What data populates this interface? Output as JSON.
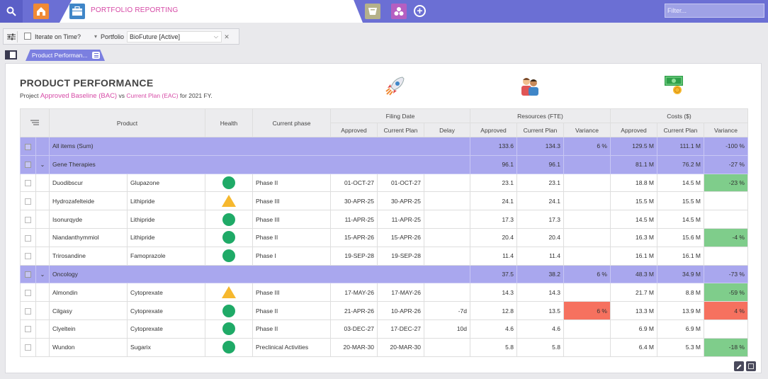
{
  "header": {
    "tab_label": "PORTFOLIO REPORTING",
    "filter_placeholder": "Filter..."
  },
  "toolbar": {
    "iterate_label": "Iterate on Time?",
    "portfolio_label": "Portfolio",
    "portfolio_value": "BioFuture [Active]"
  },
  "page_tab": {
    "label": "Product Performan..."
  },
  "report": {
    "title": "PRODUCT PERFORMANCE",
    "subtitle_prefix": "Project",
    "baseline": "Approved Baseline (BAC)",
    "vs": "vs",
    "plan": "Current Plan (EAC)",
    "suffix": "for 2021 FY."
  },
  "table": {
    "headers": {
      "product": "Product",
      "health": "Health",
      "phase": "Current phase",
      "filing": "Filing Date",
      "resources": "Resources (FTE)",
      "costs": "Costs ($)",
      "approved": "Approved",
      "current_plan": "Current Plan",
      "delay": "Delay",
      "variance": "Variance"
    },
    "rows": [
      {
        "type": "sum",
        "name": "All items (Sum)",
        "product": "",
        "health": "",
        "phase": "",
        "f_app": "",
        "f_cur": "",
        "delay": "",
        "r_app": "133.6",
        "r_cur": "134.3",
        "r_var": "6 %",
        "c_app": "129.5 M",
        "c_cur": "111.1 M",
        "c_var": "-100 %"
      },
      {
        "type": "group",
        "name": "Gene Therapies",
        "product": "",
        "health": "",
        "phase": "",
        "f_app": "",
        "f_cur": "",
        "delay": "",
        "r_app": "96.1",
        "r_cur": "96.1",
        "r_var": "",
        "c_app": "81.1 M",
        "c_cur": "76.2 M",
        "c_var": "-27 %"
      },
      {
        "type": "item",
        "name": "Duodibscur",
        "product": "Glupazone",
        "health": "green",
        "phase": "Phase II",
        "f_app": "01-OCT-27",
        "f_cur": "01-OCT-27",
        "delay": "",
        "r_app": "23.1",
        "r_cur": "23.1",
        "r_var": "",
        "c_app": "18.8 M",
        "c_cur": "14.5 M",
        "c_var": "-23 %",
        "c_var_color": "green"
      },
      {
        "type": "item",
        "name": "Hydrozafelteide",
        "product": "Lithipride",
        "health": "warning",
        "phase": "Phase III",
        "f_app": "30-APR-25",
        "f_cur": "30-APR-25",
        "delay": "",
        "r_app": "24.1",
        "r_cur": "24.1",
        "r_var": "",
        "c_app": "15.5 M",
        "c_cur": "15.5 M",
        "c_var": ""
      },
      {
        "type": "item",
        "name": "Isonurqyde",
        "product": "Lithipride",
        "health": "green",
        "phase": "Phase III",
        "f_app": "11-APR-25",
        "f_cur": "11-APR-25",
        "delay": "",
        "r_app": "17.3",
        "r_cur": "17.3",
        "r_var": "",
        "c_app": "14.5 M",
        "c_cur": "14.5 M",
        "c_var": ""
      },
      {
        "type": "item",
        "name": "Niandanthymmiol",
        "product": "Lithipride",
        "health": "green",
        "phase": "Phase II",
        "f_app": "15-APR-26",
        "f_cur": "15-APR-26",
        "delay": "",
        "r_app": "20.4",
        "r_cur": "20.4",
        "r_var": "",
        "c_app": "16.3 M",
        "c_cur": "15.6 M",
        "c_var": "-4 %",
        "c_var_color": "green"
      },
      {
        "type": "item",
        "name": "Trirosandine",
        "product": "Famoprazole",
        "health": "green",
        "phase": "Phase I",
        "f_app": "19-SEP-28",
        "f_cur": "19-SEP-28",
        "delay": "",
        "r_app": "11.4",
        "r_cur": "11.4",
        "r_var": "",
        "c_app": "16.1 M",
        "c_cur": "16.1 M",
        "c_var": ""
      },
      {
        "type": "group",
        "name": "Oncology",
        "product": "",
        "health": "",
        "phase": "",
        "f_app": "",
        "f_cur": "",
        "delay": "",
        "r_app": "37.5",
        "r_cur": "38.2",
        "r_var": "6 %",
        "c_app": "48.3 M",
        "c_cur": "34.9 M",
        "c_var": "-73 %"
      },
      {
        "type": "item",
        "name": "Almondin",
        "product": "Cytoprexate",
        "health": "warning",
        "phase": "Phase III",
        "f_app": "17-MAY-26",
        "f_cur": "17-MAY-26",
        "delay": "",
        "r_app": "14.3",
        "r_cur": "14.3",
        "r_var": "",
        "c_app": "21.7 M",
        "c_cur": "8.8 M",
        "c_var": "-59 %",
        "c_var_color": "green"
      },
      {
        "type": "item",
        "name": "Cilgasy",
        "product": "Cytoprexate",
        "health": "green",
        "phase": "Phase II",
        "f_app": "21-APR-26",
        "f_cur": "10-APR-26",
        "delay": "-7d",
        "r_app": "12.8",
        "r_cur": "13.5",
        "r_var": "6 %",
        "r_var_color": "red",
        "c_app": "13.3 M",
        "c_cur": "13.9 M",
        "c_var": "4 %",
        "c_var_color": "red"
      },
      {
        "type": "item",
        "name": "Clyeltein",
        "product": "Cytoprexate",
        "health": "green",
        "phase": "Phase II",
        "f_app": "03-DEC-27",
        "f_cur": "17-DEC-27",
        "delay": "10d",
        "r_app": "4.6",
        "r_cur": "4.6",
        "r_var": "",
        "c_app": "6.9 M",
        "c_cur": "6.9 M",
        "c_var": ""
      },
      {
        "type": "item",
        "name": "Wundon",
        "product": "Sugarix",
        "health": "green",
        "phase": "Preclinical Activities",
        "f_app": "20-MAR-30",
        "f_cur": "20-MAR-30",
        "delay": "",
        "r_app": "5.8",
        "r_cur": "5.8",
        "r_var": "",
        "c_app": "6.4 M",
        "c_cur": "5.3 M",
        "c_var": "-18 %",
        "c_var_color": "green"
      }
    ]
  },
  "colors": {
    "accent": "#6b6fd4",
    "sum_row": "#a9a7ee",
    "good": "#7fcd8b",
    "bad": "#f6715f",
    "brand_pink": "#d64aa6"
  },
  "icons": [
    "search-icon",
    "home-icon",
    "briefcase-icon",
    "box-icon",
    "hub-icon",
    "plus-icon",
    "rocket-icon",
    "people-icon",
    "money-icon",
    "edit-icon",
    "table-icon"
  ]
}
